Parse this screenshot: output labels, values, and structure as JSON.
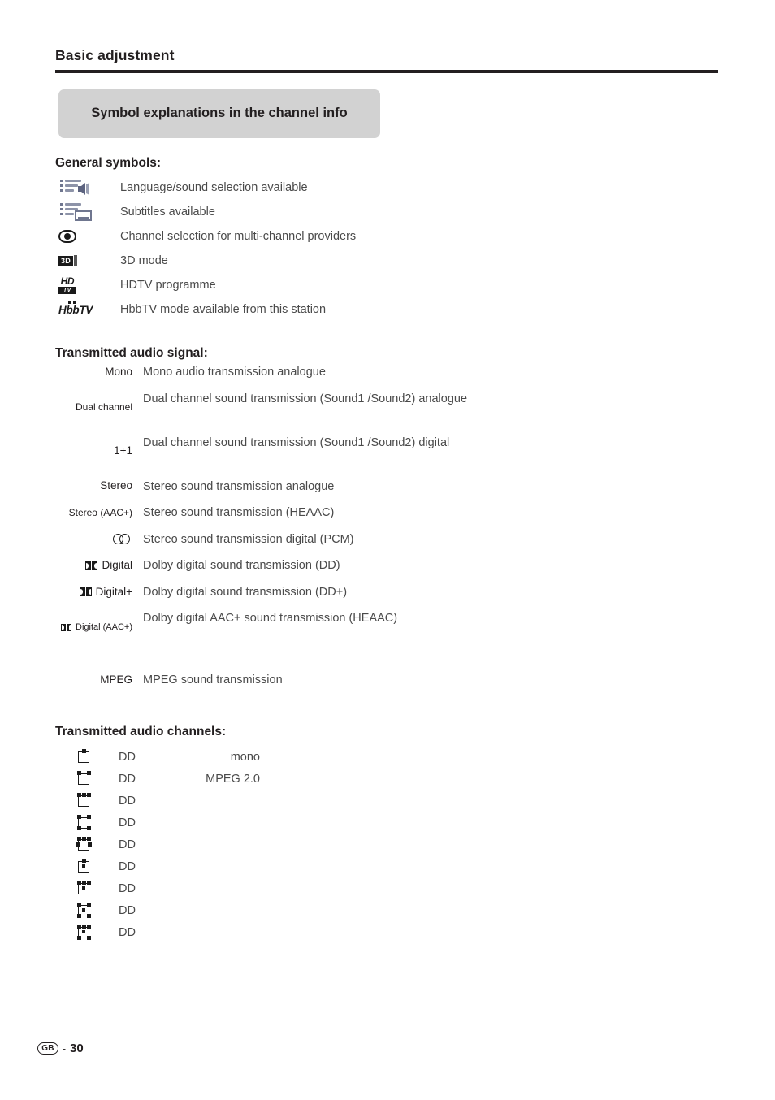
{
  "page": {
    "title": "Basic adjustment",
    "banner_title": "Symbol explanations in the channel info",
    "footer": {
      "region_code": "GB",
      "separator": "-",
      "page_number": "30"
    }
  },
  "general_symbols": {
    "heading": "General symbols:",
    "items": [
      {
        "icon": "language-sound-list-speaker-icon",
        "label": "Language/sound selection available"
      },
      {
        "icon": "subtitles-list-box-icon",
        "label": "Subtitles available"
      },
      {
        "icon": "eye-icon",
        "label": "Channel selection for multi-channel providers"
      },
      {
        "icon": "3d-mode-badge-icon",
        "label": "3D mode"
      },
      {
        "icon": "hdtv-badge-icon",
        "label": "HDTV programme"
      },
      {
        "icon": "hbbtv-logo-icon",
        "label": "HbbTV mode available from this station"
      }
    ]
  },
  "audio_signal": {
    "heading": "Transmitted audio signal:",
    "rows": [
      {
        "term": "Mono",
        "term_type": "text",
        "desc": "Mono audio transmission analogue"
      },
      {
        "term": "Dual channel",
        "term_type": "text",
        "desc": "Dual channel sound transmission (Sound1 /Sound2) analogue"
      },
      {
        "term": "1+1",
        "term_type": "text",
        "desc": "Dual channel sound transmission (Sound1 /Sound2) digital"
      },
      {
        "term": "Stereo",
        "term_type": "text",
        "desc": "Stereo sound transmission analogue"
      },
      {
        "term": "Stereo (AAC+)",
        "term_type": "text",
        "desc": "Stereo sound transmission (HEAAC)"
      },
      {
        "term": "",
        "term_type": "pcm-double-circle-icon",
        "desc": "Stereo sound transmission digital (PCM)"
      },
      {
        "term": "Digital",
        "term_type": "dolby",
        "desc": "Dolby digital sound transmission (DD)"
      },
      {
        "term": "Digital+",
        "term_type": "dolby",
        "desc": "Dolby digital sound transmission (DD+)"
      },
      {
        "term": "Digital (AAC+)",
        "term_type": "dolby-small",
        "desc": "Dolby digital AAC+ sound transmission (HEAAC)"
      },
      {
        "term": "MPEG",
        "term_type": "text",
        "desc": "MPEG sound transmission"
      }
    ]
  },
  "audio_channels": {
    "heading": "Transmitted audio channels:",
    "rows": [
      {
        "icon": "speaker-layout-mono-icon",
        "codec": "DD",
        "note": "mono"
      },
      {
        "icon": "speaker-layout-stereo-icon",
        "codec": "DD",
        "note": "MPEG 2.0"
      },
      {
        "icon": "speaker-layout-3front-icon",
        "codec": "DD",
        "note": ""
      },
      {
        "icon": "speaker-layout-quad-icon",
        "codec": "DD",
        "note": ""
      },
      {
        "icon": "speaker-layout-3front-side-icon",
        "codec": "DD",
        "note": ""
      },
      {
        "icon": "speaker-layout-center-icon",
        "codec": "DD",
        "note": ""
      },
      {
        "icon": "speaker-layout-3front-lfe-icon",
        "codec": "DD",
        "note": ""
      },
      {
        "icon": "speaker-layout-quad-lfe-icon",
        "codec": "DD",
        "note": ""
      },
      {
        "icon": "speaker-layout-51-icon",
        "codec": "DD",
        "note": ""
      }
    ]
  }
}
